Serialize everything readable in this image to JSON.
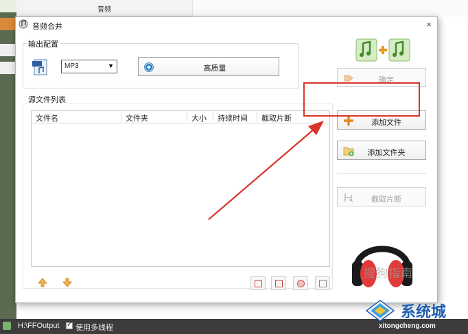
{
  "background_app": {
    "top_label": "音频",
    "bottom_path": "H:\\FFOutput",
    "bottom_checkbox_label": "使用多线程"
  },
  "dialog": {
    "title": "音频合并",
    "close_symbol": "×",
    "output_config": {
      "group_label": "输出配置",
      "format_value": "MP3",
      "quality_label": "高质量"
    },
    "source_list": {
      "group_label": "源文件列表",
      "columns": [
        "文件名",
        "文件夹",
        "大小",
        "持续时间",
        "截取片断"
      ]
    },
    "buttons": {
      "confirm": "确定",
      "add_file": "添加文件",
      "add_folder": "添加文件夹",
      "clip": "截取片断"
    }
  },
  "watermarks": {
    "sogou": "搜狗指南",
    "site_name": "系统城",
    "site_url": "xitongcheng.com"
  },
  "colors": {
    "highlight": "#d9342b",
    "headphones": "#e03a3a",
    "logo_blue": "#1e5fb0"
  },
  "icons": {
    "merge_header": "music-merge-icon",
    "headphones": "headphones-icon"
  }
}
